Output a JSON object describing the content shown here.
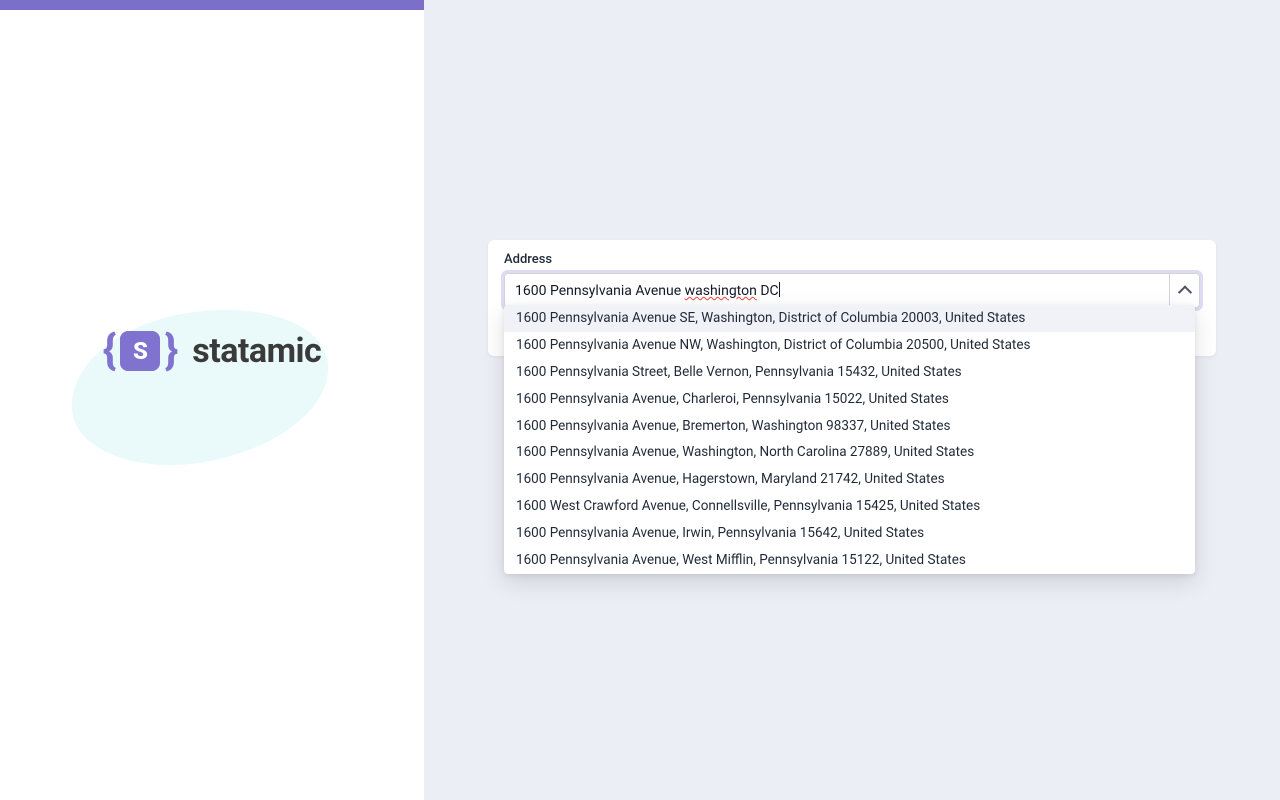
{
  "brand": {
    "name": "statamic",
    "initial": "S"
  },
  "field": {
    "label": "Address",
    "value_prefix": "1600 Pennsylvania Avenue ",
    "value_misspelled": "washington",
    "value_suffix": " DC"
  },
  "suggestions": [
    "1600 Pennsylvania Avenue SE, Washington, District of Columbia 20003, United States",
    "1600 Pennsylvania Avenue NW, Washington, District of Columbia 20500, United States",
    "1600 Pennsylvania Street, Belle Vernon, Pennsylvania 15432, United States",
    "1600 Pennsylvania Avenue, Charleroi, Pennsylvania 15022, United States",
    "1600 Pennsylvania Avenue, Bremerton, Washington 98337, United States",
    "1600 Pennsylvania Avenue, Washington, North Carolina 27889, United States",
    "1600 Pennsylvania Avenue, Hagerstown, Maryland 21742, United States",
    "1600 West Crawford Avenue, Connellsville, Pennsylvania 15425, United States",
    "1600 Pennsylvania Avenue, Irwin, Pennsylvania 15642, United States",
    "1600 Pennsylvania Avenue, West Mifflin, Pennsylvania 15122, United States"
  ],
  "highlighted_index": 0
}
